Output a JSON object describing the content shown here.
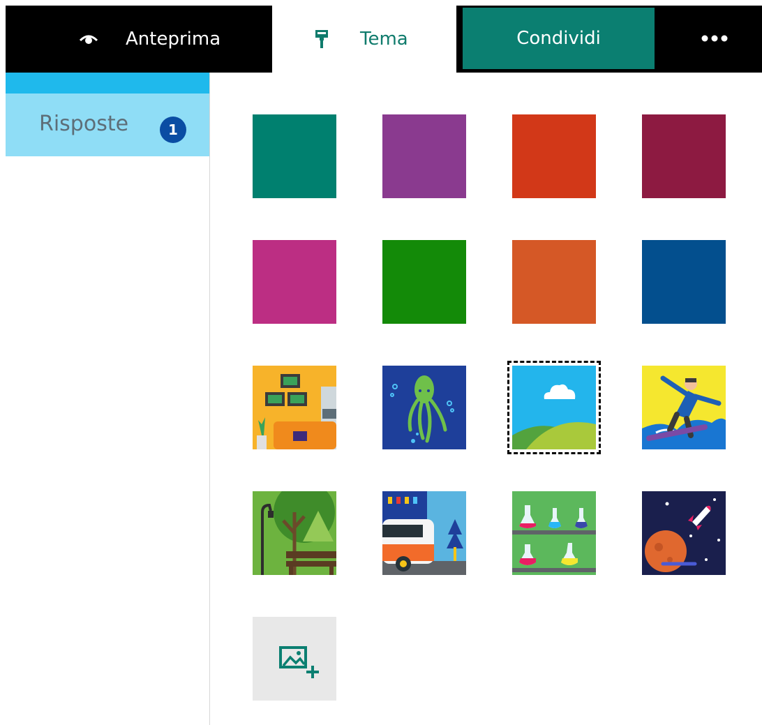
{
  "toolbar": {
    "preview_label": "Anteprima",
    "preview_icon": "eye-icon",
    "theme_label": "Tema",
    "theme_icon": "paint-roller-icon",
    "share_label": "Condividi",
    "more_icon": "ellipsis-icon"
  },
  "sidebar": {
    "responses_label": "Risposte",
    "responses_count": "1"
  },
  "theme_grid": {
    "solid_colors": [
      "#00806f",
      "#8a3a8f",
      "#d23818",
      "#8d1a41",
      "#bc2e83",
      "#138a08",
      "#d55826",
      "#034f8e"
    ],
    "image_themes": [
      "living-room",
      "octopus",
      "sky-hills",
      "snowboarder",
      "park",
      "city-van",
      "science-lab",
      "space"
    ],
    "selected": "sky-hills",
    "upload_icon": "add-image-icon"
  },
  "colors": {
    "accent": "#0b7f71",
    "sidebar_active": "#8fddf6",
    "sidebar_strip": "#1fb9ec",
    "badge": "#0a4da3"
  }
}
